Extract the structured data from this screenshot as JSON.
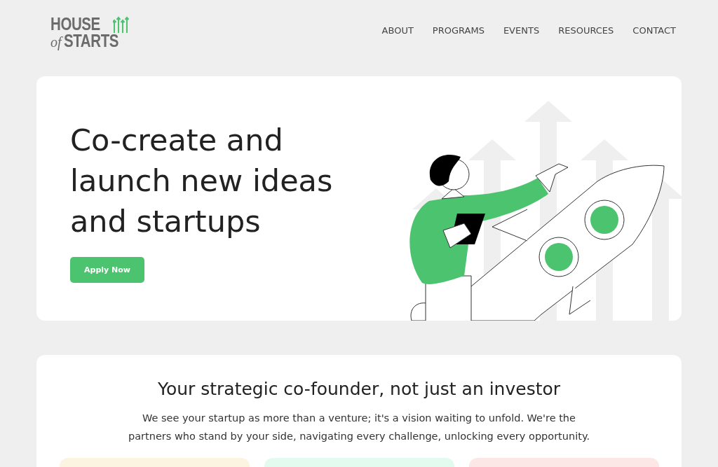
{
  "logo": {
    "top": "HOUSE",
    "small": "of",
    "bottom": "STARTS"
  },
  "nav": [
    {
      "label": "ABOUT"
    },
    {
      "label": "PROGRAMS"
    },
    {
      "label": "EVENTS"
    },
    {
      "label": "RESOURCES"
    },
    {
      "label": "CONTACT"
    }
  ],
  "hero": {
    "heading": "Co-create and launch new ideas and startups",
    "button": "Apply Now"
  },
  "intro": {
    "heading": "Your strategic co-founder, not just an investor",
    "text": "We see your startup as more than a venture; it's a vision waiting to unfold. We're the partners who stand by your side, navigating every challenge, unlocking every opportunity.",
    "cards": [
      {
        "color": "#fdf3e1"
      },
      {
        "color": "#e3faee"
      },
      {
        "color": "#fde6e6"
      }
    ]
  }
}
